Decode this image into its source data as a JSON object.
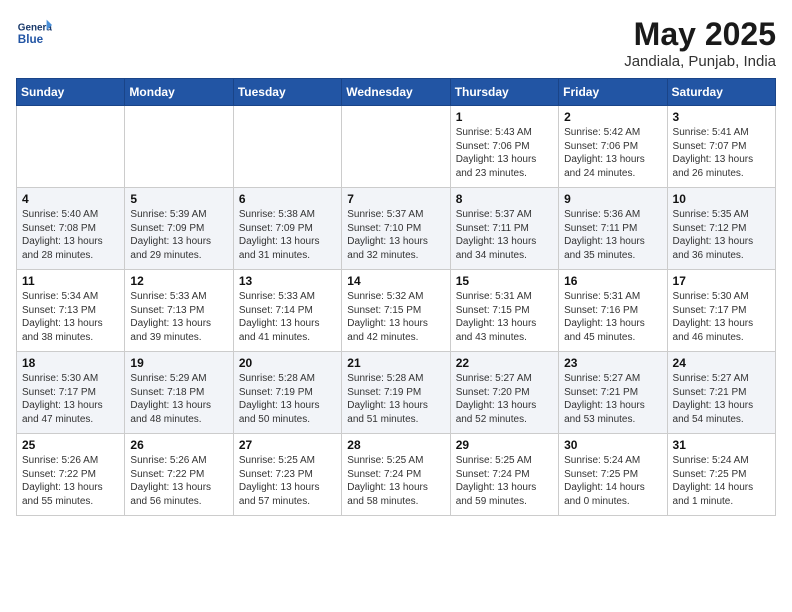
{
  "header": {
    "logo_line1": "General",
    "logo_line2": "Blue",
    "month_year": "May 2025",
    "location": "Jandiala, Punjab, India"
  },
  "weekdays": [
    "Sunday",
    "Monday",
    "Tuesday",
    "Wednesday",
    "Thursday",
    "Friday",
    "Saturday"
  ],
  "weeks": [
    [
      {
        "day": "",
        "info": ""
      },
      {
        "day": "",
        "info": ""
      },
      {
        "day": "",
        "info": ""
      },
      {
        "day": "",
        "info": ""
      },
      {
        "day": "1",
        "info": "Sunrise: 5:43 AM\nSunset: 7:06 PM\nDaylight: 13 hours\nand 23 minutes."
      },
      {
        "day": "2",
        "info": "Sunrise: 5:42 AM\nSunset: 7:06 PM\nDaylight: 13 hours\nand 24 minutes."
      },
      {
        "day": "3",
        "info": "Sunrise: 5:41 AM\nSunset: 7:07 PM\nDaylight: 13 hours\nand 26 minutes."
      }
    ],
    [
      {
        "day": "4",
        "info": "Sunrise: 5:40 AM\nSunset: 7:08 PM\nDaylight: 13 hours\nand 28 minutes."
      },
      {
        "day": "5",
        "info": "Sunrise: 5:39 AM\nSunset: 7:09 PM\nDaylight: 13 hours\nand 29 minutes."
      },
      {
        "day": "6",
        "info": "Sunrise: 5:38 AM\nSunset: 7:09 PM\nDaylight: 13 hours\nand 31 minutes."
      },
      {
        "day": "7",
        "info": "Sunrise: 5:37 AM\nSunset: 7:10 PM\nDaylight: 13 hours\nand 32 minutes."
      },
      {
        "day": "8",
        "info": "Sunrise: 5:37 AM\nSunset: 7:11 PM\nDaylight: 13 hours\nand 34 minutes."
      },
      {
        "day": "9",
        "info": "Sunrise: 5:36 AM\nSunset: 7:11 PM\nDaylight: 13 hours\nand 35 minutes."
      },
      {
        "day": "10",
        "info": "Sunrise: 5:35 AM\nSunset: 7:12 PM\nDaylight: 13 hours\nand 36 minutes."
      }
    ],
    [
      {
        "day": "11",
        "info": "Sunrise: 5:34 AM\nSunset: 7:13 PM\nDaylight: 13 hours\nand 38 minutes."
      },
      {
        "day": "12",
        "info": "Sunrise: 5:33 AM\nSunset: 7:13 PM\nDaylight: 13 hours\nand 39 minutes."
      },
      {
        "day": "13",
        "info": "Sunrise: 5:33 AM\nSunset: 7:14 PM\nDaylight: 13 hours\nand 41 minutes."
      },
      {
        "day": "14",
        "info": "Sunrise: 5:32 AM\nSunset: 7:15 PM\nDaylight: 13 hours\nand 42 minutes."
      },
      {
        "day": "15",
        "info": "Sunrise: 5:31 AM\nSunset: 7:15 PM\nDaylight: 13 hours\nand 43 minutes."
      },
      {
        "day": "16",
        "info": "Sunrise: 5:31 AM\nSunset: 7:16 PM\nDaylight: 13 hours\nand 45 minutes."
      },
      {
        "day": "17",
        "info": "Sunrise: 5:30 AM\nSunset: 7:17 PM\nDaylight: 13 hours\nand 46 minutes."
      }
    ],
    [
      {
        "day": "18",
        "info": "Sunrise: 5:30 AM\nSunset: 7:17 PM\nDaylight: 13 hours\nand 47 minutes."
      },
      {
        "day": "19",
        "info": "Sunrise: 5:29 AM\nSunset: 7:18 PM\nDaylight: 13 hours\nand 48 minutes."
      },
      {
        "day": "20",
        "info": "Sunrise: 5:28 AM\nSunset: 7:19 PM\nDaylight: 13 hours\nand 50 minutes."
      },
      {
        "day": "21",
        "info": "Sunrise: 5:28 AM\nSunset: 7:19 PM\nDaylight: 13 hours\nand 51 minutes."
      },
      {
        "day": "22",
        "info": "Sunrise: 5:27 AM\nSunset: 7:20 PM\nDaylight: 13 hours\nand 52 minutes."
      },
      {
        "day": "23",
        "info": "Sunrise: 5:27 AM\nSunset: 7:21 PM\nDaylight: 13 hours\nand 53 minutes."
      },
      {
        "day": "24",
        "info": "Sunrise: 5:27 AM\nSunset: 7:21 PM\nDaylight: 13 hours\nand 54 minutes."
      }
    ],
    [
      {
        "day": "25",
        "info": "Sunrise: 5:26 AM\nSunset: 7:22 PM\nDaylight: 13 hours\nand 55 minutes."
      },
      {
        "day": "26",
        "info": "Sunrise: 5:26 AM\nSunset: 7:22 PM\nDaylight: 13 hours\nand 56 minutes."
      },
      {
        "day": "27",
        "info": "Sunrise: 5:25 AM\nSunset: 7:23 PM\nDaylight: 13 hours\nand 57 minutes."
      },
      {
        "day": "28",
        "info": "Sunrise: 5:25 AM\nSunset: 7:24 PM\nDaylight: 13 hours\nand 58 minutes."
      },
      {
        "day": "29",
        "info": "Sunrise: 5:25 AM\nSunset: 7:24 PM\nDaylight: 13 hours\nand 59 minutes."
      },
      {
        "day": "30",
        "info": "Sunrise: 5:24 AM\nSunset: 7:25 PM\nDaylight: 14 hours\nand 0 minutes."
      },
      {
        "day": "31",
        "info": "Sunrise: 5:24 AM\nSunset: 7:25 PM\nDaylight: 14 hours\nand 1 minute."
      }
    ]
  ]
}
